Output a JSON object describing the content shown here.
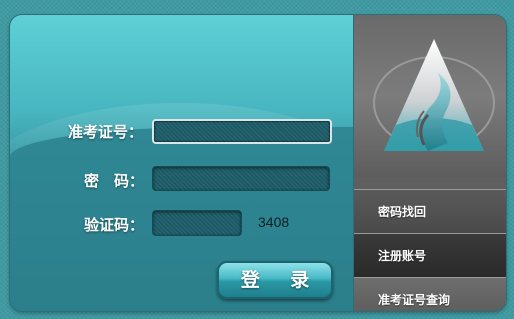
{
  "form": {
    "exam_id_label": "准考证号：",
    "password_label": "密　码：",
    "captcha_label": "验证码：",
    "exam_id_value": "",
    "password_value": "",
    "captcha_value": "",
    "captcha_code": "3408",
    "login_label": "登 录"
  },
  "menu": {
    "items": [
      {
        "label": "密码找回"
      },
      {
        "label": "注册账号"
      },
      {
        "label": "准考证号查询"
      }
    ]
  },
  "logo": {
    "icon": "triangle-flame-logo-icon"
  },
  "colors": {
    "panel_light": "#5fd0d6",
    "panel_dark": "#2a7a86",
    "menu_gray": "#5a5a5a",
    "field_bg": "#1c5a66"
  }
}
